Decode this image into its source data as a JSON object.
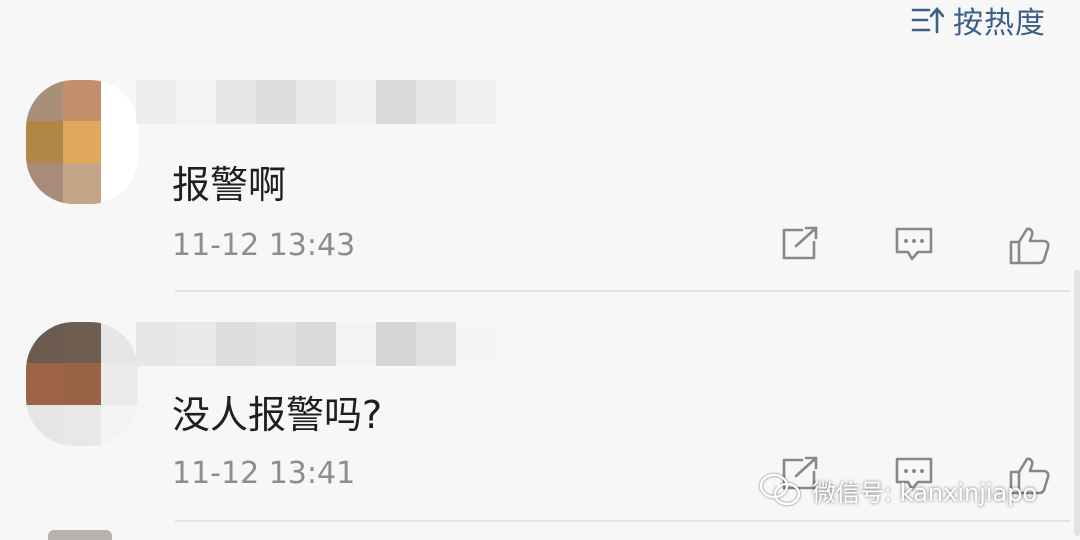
{
  "header": {
    "sort_label": "按热度",
    "sort_icon": "sort-icon"
  },
  "comments": [
    {
      "text": "报警啊",
      "time": "11-12 13:43",
      "avatar_colors": [
        "#a88f79",
        "#c68f6b",
        "#ffffff",
        "#b28745",
        "#e1a75a",
        "#ffffff",
        "#a88c79",
        "#c4a587",
        "#ffffff"
      ],
      "nick_colors": [
        "#eeeeee",
        "#f3f3f3",
        "#e7e7e7",
        "#dddddd",
        "#e9e9e9",
        "#f2f2f2",
        "#dadada",
        "#e7e7e7",
        "#efefef"
      ]
    },
    {
      "text": "没人报警吗?",
      "time": "11-12 13:41",
      "avatar_colors": [
        "#6c5a4e",
        "#6f5d50",
        "#e6e6e6",
        "#9c6346",
        "#9a6246",
        "#ebebeb",
        "#e5e5e5",
        "#e8e8e8",
        "#f3f3f3"
      ],
      "nick_colors": [
        "#e7e7e7",
        "#e9e9e9",
        "#dddddd",
        "#e2e2e2",
        "#d9d9d9",
        "#f3f3f3",
        "#d6d6d6",
        "#e1e1e1",
        "#f5f5f5"
      ]
    }
  ],
  "actions": [
    "share-icon",
    "reply-icon",
    "like-icon"
  ],
  "watermark": {
    "text": "微信号: kanxinjiapo",
    "icon": "wechat-icon"
  }
}
